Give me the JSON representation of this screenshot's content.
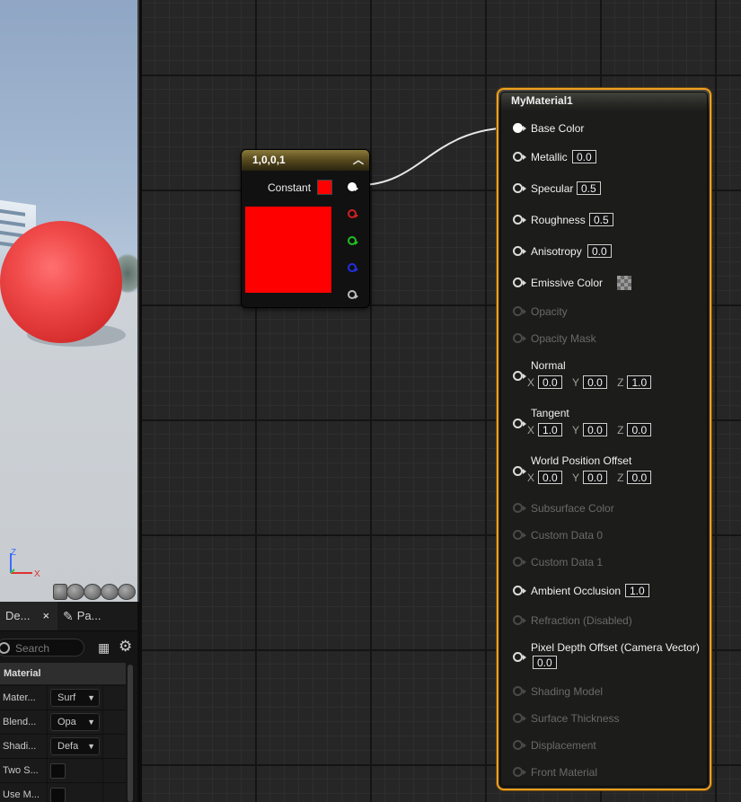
{
  "viewport": {
    "axis_z": "Z",
    "axis_x": "X",
    "preview_shapes": [
      "cylinder-icon",
      "sphere-icon",
      "plane-icon",
      "cube-icon",
      "teapot-icon"
    ]
  },
  "details": {
    "tabs": [
      {
        "label": "De...",
        "close": "×"
      },
      {
        "label": "Pa..."
      }
    ],
    "search_placeholder": "Search",
    "section": "Material",
    "properties": [
      {
        "label": "Mater...",
        "value": "Surf"
      },
      {
        "label": "Blend...",
        "value": "Opa"
      },
      {
        "label": "Shadi...",
        "value": "Defa"
      },
      {
        "label": "Two S...",
        "checked": false
      },
      {
        "label": "Use M...",
        "checked": false
      }
    ]
  },
  "constant_node": {
    "title": "1,0,0,1",
    "output_label": "Constant",
    "color": "#ff0000"
  },
  "material_node": {
    "title": "MyMaterial1",
    "inputs": {
      "base_color": "Base Color",
      "metallic": "Metallic",
      "metallic_val": "0.0",
      "specular": "Specular",
      "specular_val": "0.5",
      "roughness": "Roughness",
      "roughness_val": "0.5",
      "anisotropy": "Anisotropy",
      "anisotropy_val": "0.0",
      "emissive": "Emissive Color",
      "opacity": "Opacity",
      "opacity_mask": "Opacity Mask",
      "normal": "Normal",
      "normal_x": "0.0",
      "normal_y": "0.0",
      "normal_z": "1.0",
      "tangent": "Tangent",
      "tangent_x": "1.0",
      "tangent_y": "0.0",
      "tangent_z": "0.0",
      "wpo": "World Position Offset",
      "wpo_x": "0.0",
      "wpo_y": "0.0",
      "wpo_z": "0.0",
      "subsurface": "Subsurface Color",
      "custom0": "Custom Data 0",
      "custom1": "Custom Data 1",
      "ao": "Ambient Occlusion",
      "ao_val": "1.0",
      "refraction": "Refraction (Disabled)",
      "pdo": "Pixel Depth Offset (Camera Vector)",
      "pdo_val": "0.0",
      "shading_model": "Shading Model",
      "surface_thickness": "Surface Thickness",
      "displacement": "Displacement",
      "front_material": "Front Material"
    },
    "axis_labels": {
      "x": "X",
      "y": "Y",
      "z": "Z"
    }
  },
  "colors": {
    "accent_selection": "#f0a020",
    "constant_red": "#ff0000"
  }
}
